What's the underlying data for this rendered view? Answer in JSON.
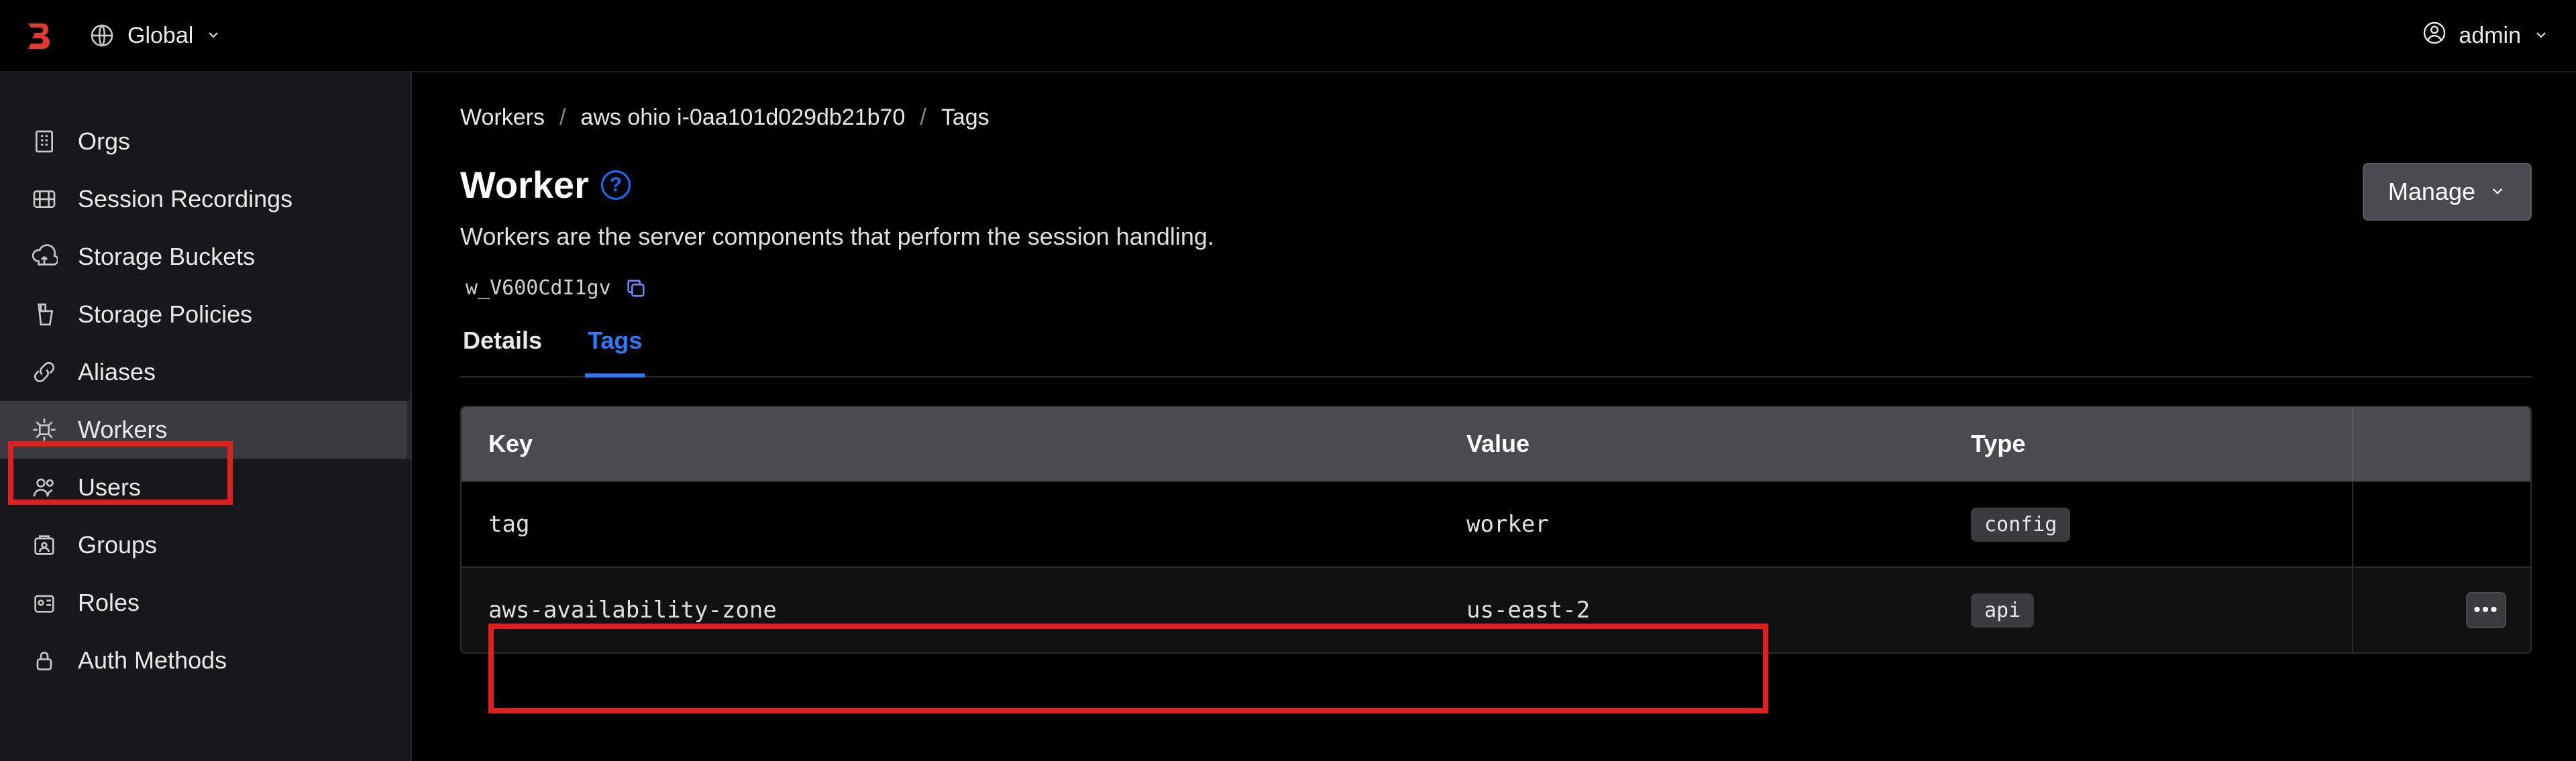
{
  "topbar": {
    "scope_label": "Global",
    "user_label": "admin"
  },
  "sidebar": {
    "items": [
      {
        "icon": "orgs",
        "label": "Orgs"
      },
      {
        "icon": "recordings",
        "label": "Session Recordings"
      },
      {
        "icon": "buckets",
        "label": "Storage Buckets"
      },
      {
        "icon": "policies",
        "label": "Storage Policies"
      },
      {
        "icon": "aliases",
        "label": "Aliases"
      },
      {
        "icon": "workers",
        "label": "Workers",
        "active": true
      },
      {
        "icon": "users",
        "label": "Users"
      },
      {
        "icon": "groups",
        "label": "Groups"
      },
      {
        "icon": "roles",
        "label": "Roles"
      },
      {
        "icon": "auth",
        "label": "Auth Methods"
      }
    ]
  },
  "breadcrumb": {
    "items": [
      {
        "label": "Workers",
        "link": true
      },
      {
        "label": "aws ohio i-0aa101d029db21b70",
        "link": true
      },
      {
        "label": "Tags",
        "link": false
      }
    ]
  },
  "page": {
    "title": "Worker",
    "description": "Workers are the server components that perform the session handling.",
    "worker_id": "w_V600CdI1gv",
    "manage_label": "Manage"
  },
  "tabs": [
    {
      "label": "Details",
      "active": false
    },
    {
      "label": "Tags",
      "active": true
    }
  ],
  "tags_table": {
    "headers": {
      "key": "Key",
      "value": "Value",
      "type": "Type"
    },
    "rows": [
      {
        "key": "tag",
        "value": "worker",
        "type": "config",
        "has_actions": false
      },
      {
        "key": "aws-availability-zone",
        "value": "us-east-2",
        "type": "api",
        "has_actions": true
      }
    ]
  },
  "colors": {
    "accent": "#2a7bff",
    "annotation_red": "#e02020"
  }
}
